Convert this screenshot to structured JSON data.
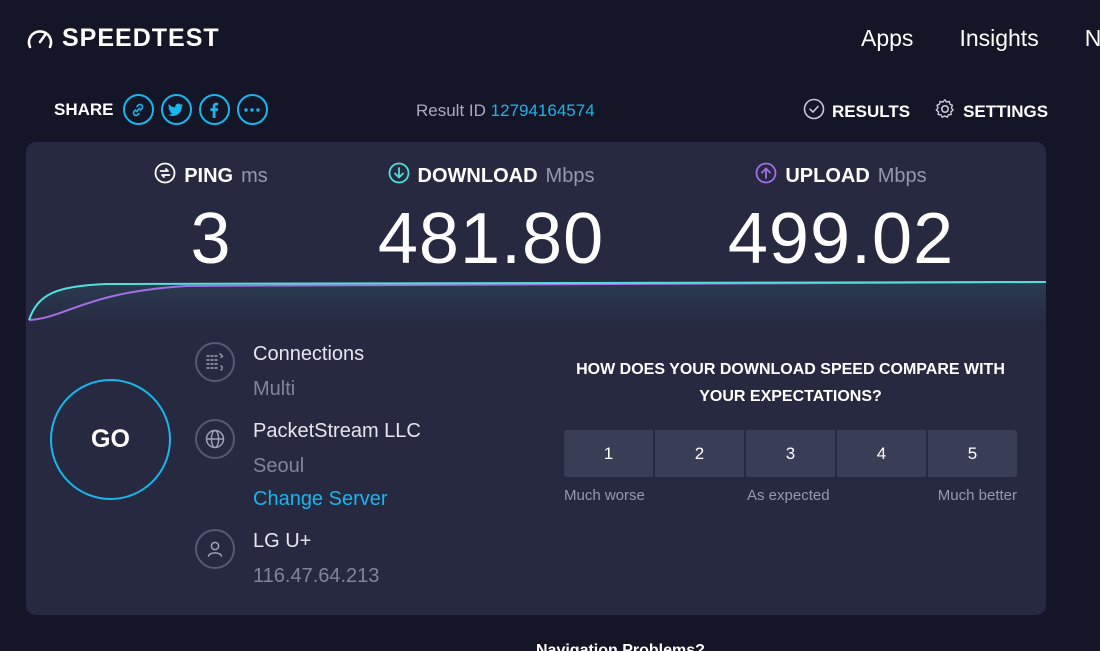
{
  "brand": {
    "logo_text": "SPEEDTEST"
  },
  "nav": {
    "items": [
      "Apps",
      "Insights",
      "N"
    ]
  },
  "share": {
    "label": "SHARE",
    "buttons": [
      "link-icon",
      "twitter-icon",
      "facebook-icon",
      "more-icon"
    ]
  },
  "result": {
    "label": "Result ID",
    "id": "12794164574"
  },
  "actions": {
    "results": "RESULTS",
    "settings": "SETTINGS"
  },
  "metrics": {
    "ping": {
      "label": "PING",
      "unit": "ms",
      "value": "3"
    },
    "download": {
      "label": "DOWNLOAD",
      "unit": "Mbps",
      "value": "481.80"
    },
    "upload": {
      "label": "UPLOAD",
      "unit": "Mbps",
      "value": "499.02"
    }
  },
  "go_label": "GO",
  "connections": {
    "label": "Connections",
    "value": "Multi"
  },
  "server": {
    "name": "PacketStream LLC",
    "location": "Seoul",
    "change_label": "Change Server"
  },
  "isp": {
    "name": "LG U+",
    "ip": "116.47.64.213"
  },
  "survey": {
    "question": "HOW DOES YOUR DOWNLOAD SPEED COMPARE WITH YOUR EXPECTATIONS?",
    "options": [
      "1",
      "2",
      "3",
      "4",
      "5"
    ],
    "scale_low": "Much worse",
    "scale_mid": "As expected",
    "scale_high": "Much better"
  },
  "bottom_text": "Navigation  Problems?",
  "colors": {
    "accent": "#1ab5ec",
    "upload": "#a46ee6",
    "download_line": "#4fe0d9",
    "background": "#141526",
    "card": "#262940"
  }
}
